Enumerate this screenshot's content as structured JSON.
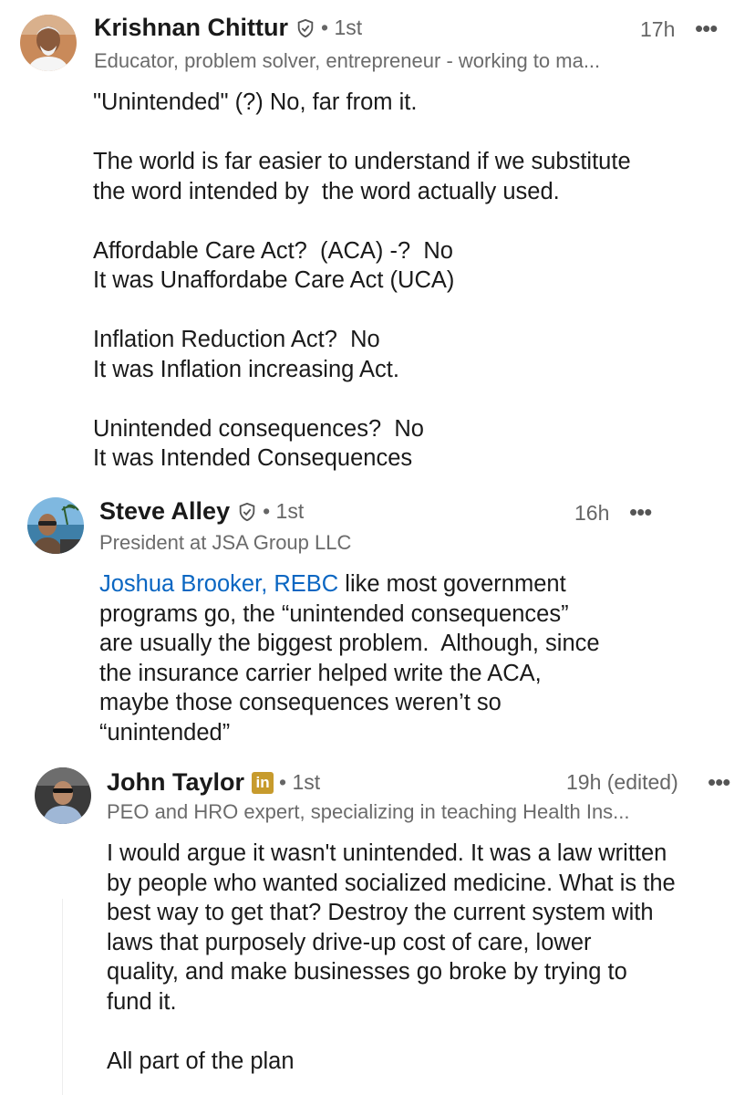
{
  "comments": [
    {
      "name": "Krishnan Chittur",
      "badge": "verified",
      "degree": "• 1st",
      "time": "17h",
      "more": "•••",
      "headline": "Educator, problem solver, entrepreneur - working to ma...",
      "body": "\"Unintended\" (?) No, far from it.\n\nThe world is far easier to understand if we substitute\nthe word intended by  the word actually used.\n\nAffordable Care Act?  (ACA) -?  No\nIt was Unaffordabe Care Act (UCA)\n\nInflation Reduction Act?  No\nIt was Inflation increasing Act.\n\nUnintended consequences?  No\nIt was Intended Consequences"
    },
    {
      "name": "Steve Alley",
      "badge": "verified",
      "degree": "• 1st",
      "time": "16h",
      "more": "•••",
      "headline": "President at JSA Group LLC",
      "mention": "Joshua Brooker, REBC",
      "body": " like most government\nprograms go, the “unintended consequences”\nare usually the biggest problem.  Although, since\nthe insurance carrier helped write the ACA,\nmaybe those consequences weren’t so\n“unintended”"
    },
    {
      "name": "John Taylor",
      "badge": "linkedin-premium",
      "badge_text": "in",
      "degree": "• 1st",
      "time": "19h (edited)",
      "more": "•••",
      "headline": "PEO and HRO expert, specializing in teaching Health Ins...",
      "body": "I would argue it wasn't unintended. It was a law written\nby people who wanted socialized medicine. What is the\nbest way to get that? Destroy the current system with\nlaws that purposely drive-up cost of care, lower\nquality, and make businesses go broke by trying to\nfund it.\n\nAll part of the plan"
    }
  ],
  "colors": {
    "mention": "#0a66c2",
    "premium_badge": "#c79b2d",
    "secondary_text": "#666666"
  }
}
